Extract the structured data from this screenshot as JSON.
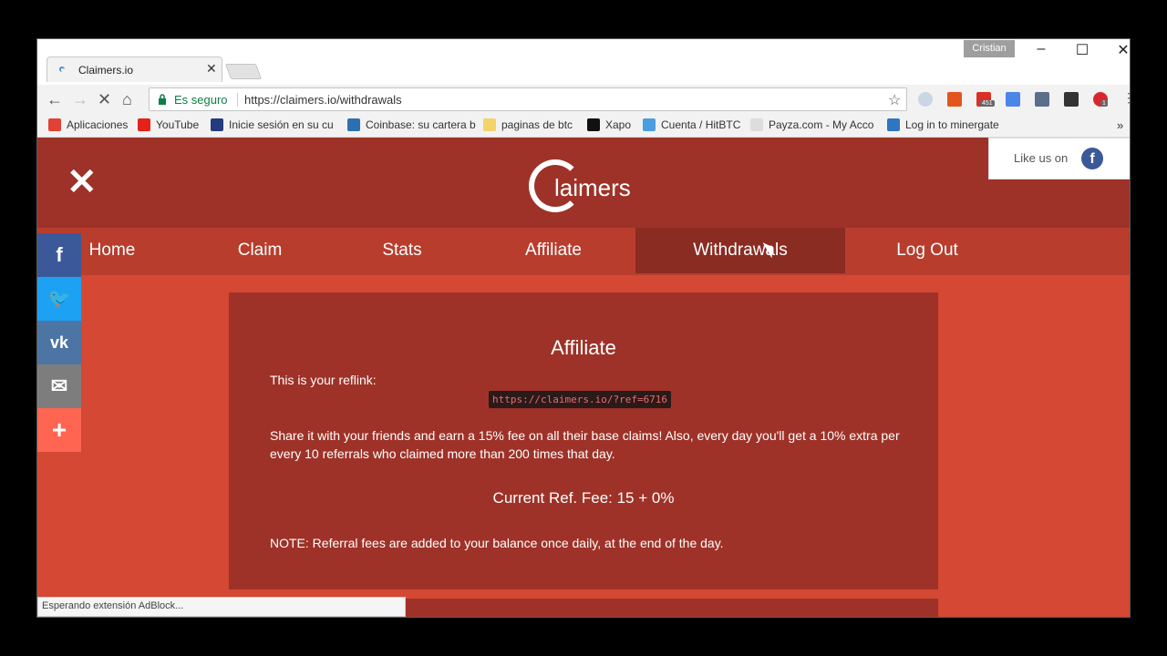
{
  "browser": {
    "tab_title": "Claimers.io",
    "profile_name": "Cristian",
    "secure_label": "Es seguro",
    "url": "https://claimers.io/withdrawals",
    "status_text": "Esperando extensión AdBlock...",
    "extension_badges": [
      "451",
      "1"
    ],
    "bookmarks": [
      {
        "label": "Aplicaciones",
        "icon": "apps-grid-icon",
        "color": "#e34133"
      },
      {
        "label": "YouTube",
        "icon": "youtube-icon",
        "color": "#e62117"
      },
      {
        "label": "Inicie sesión en su cu",
        "icon": "paypal-icon",
        "color": "#253b80"
      },
      {
        "label": "Coinbase: su cartera b",
        "icon": "coinbase-icon",
        "color": "#2b71b1"
      },
      {
        "label": "paginas de btc",
        "icon": "folder-icon",
        "color": "#f5d36b"
      },
      {
        "label": "Xapo",
        "icon": "xapo-icon",
        "color": "#111111"
      },
      {
        "label": "Cuenta / HitBTC",
        "icon": "hitbtc-icon",
        "color": "#4a9ee0"
      },
      {
        "label": "Payza.com - My Acco",
        "icon": "payza-icon",
        "color": "#333333"
      },
      {
        "label": "Log in to minergate",
        "icon": "minergate-icon",
        "color": "#2f76c0"
      }
    ]
  },
  "site": {
    "logo_text": "laimers",
    "like_label": "Like us on",
    "nav": [
      {
        "label": "Home",
        "active": false
      },
      {
        "label": "Claim",
        "active": false
      },
      {
        "label": "Stats",
        "active": false
      },
      {
        "label": "Affiliate",
        "active": false
      },
      {
        "label": "Withdrawals",
        "active": true
      },
      {
        "label": "Log Out",
        "active": false
      }
    ],
    "social": [
      {
        "icon": "facebook-icon",
        "glyph": "f",
        "color": "#3b5998"
      },
      {
        "icon": "twitter-icon",
        "glyph": "🐦",
        "color": "#1da1f2"
      },
      {
        "icon": "vk-icon",
        "glyph": "vk",
        "color": "#4c75a3"
      },
      {
        "icon": "email-icon",
        "glyph": "✉",
        "color": "#7d7d7d"
      },
      {
        "icon": "plus-icon",
        "glyph": "+",
        "color": "#ff6550"
      }
    ]
  },
  "affiliate": {
    "title": "Affiliate",
    "reflink_label": "This is your reflink:",
    "reflink": "https://claimers.io/?ref=6716",
    "description": "Share it with your friends and earn a 15% fee on all their base claims! Also, every day you'll get a 10% extra per every 10 referrals who claimed more than 200 times that day.",
    "current_fee": "Current Ref. Fee: 15 + 0%",
    "note": "NOTE: Referral fees are added to your balance once daily, at the end of the day."
  },
  "colors": {
    "page_bg": "#d44834",
    "header_bg": "#9e3228",
    "nav_bg": "#b83d2d",
    "nav_active": "#8a2c22"
  }
}
